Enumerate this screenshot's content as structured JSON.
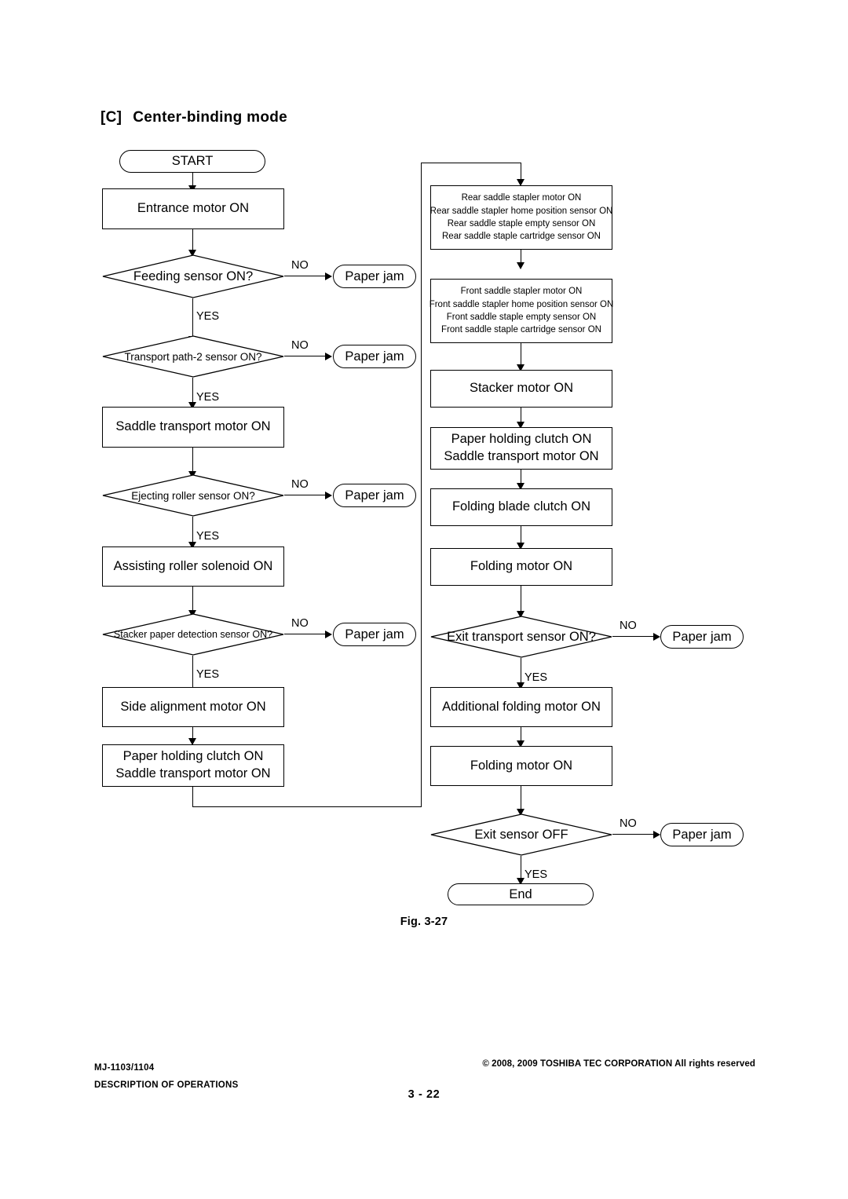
{
  "heading": {
    "tag": "[C]",
    "title": "Center-binding mode"
  },
  "figure_caption": "Fig. 3-27",
  "footer": {
    "model": "MJ-1103/1104",
    "section": "DESCRIPTION OF OPERATIONS",
    "copyright": "© 2008, 2009 TOSHIBA TEC CORPORATION All rights reserved",
    "page": "3 - 22"
  },
  "labels": {
    "yes": "YES",
    "no": "NO"
  },
  "flow": {
    "start": "START",
    "end": "End",
    "paper_jam": "Paper jam",
    "left_column": [
      {
        "id": "entrance-motor-on",
        "type": "process",
        "lines": [
          "Entrance motor ON"
        ]
      },
      {
        "id": "feeding-sensor-on",
        "type": "decision",
        "lines": [
          "Feeding sensor ON?"
        ]
      },
      {
        "id": "transport-path-2-sensor-on",
        "type": "decision",
        "lines": [
          "Transport path-2 sensor ON?"
        ]
      },
      {
        "id": "saddle-transport-motor-on",
        "type": "process",
        "lines": [
          "Saddle transport motor ON"
        ]
      },
      {
        "id": "ejecting-roller-sensor-on",
        "type": "decision",
        "lines": [
          "Ejecting roller sensor ON?"
        ]
      },
      {
        "id": "assisting-roller-solenoid-on",
        "type": "process",
        "lines": [
          "Assisting roller solenoid ON"
        ]
      },
      {
        "id": "stacker-paper-detection-sensor-on",
        "type": "decision",
        "lines": [
          "Stacker paper detection sensor ON?"
        ]
      },
      {
        "id": "side-alignment-motor-on",
        "type": "process",
        "lines": [
          "Side alignment motor ON"
        ]
      },
      {
        "id": "paper-holding-clutch-on-1",
        "type": "process",
        "lines": [
          "Paper holding clutch ON",
          "Saddle transport motor ON"
        ]
      }
    ],
    "right_column": [
      {
        "id": "rear-saddle-stapler-block",
        "type": "process",
        "lines": [
          "Rear saddle stapler motor ON",
          "Rear saddle stapler home position sensor ON",
          "Rear saddle staple empty sensor ON",
          "Rear saddle staple cartridge sensor  ON"
        ]
      },
      {
        "id": "front-saddle-stapler-block",
        "type": "process",
        "lines": [
          "Front saddle stapler motor ON",
          "Front saddle stapler home position sensor ON",
          "Front saddle staple empty sensor ON",
          "Front saddle staple cartridge sensor  ON"
        ]
      },
      {
        "id": "stacker-motor-on",
        "type": "process",
        "lines": [
          "Stacker motor ON"
        ]
      },
      {
        "id": "paper-holding-clutch-on-2",
        "type": "process",
        "lines": [
          "Paper holding clutch ON",
          "Saddle transport motor ON"
        ]
      },
      {
        "id": "folding-blade-clutch-on",
        "type": "process",
        "lines": [
          "Folding blade clutch ON"
        ]
      },
      {
        "id": "folding-motor-on-1",
        "type": "process",
        "lines": [
          "Folding motor ON"
        ]
      },
      {
        "id": "exit-transport-sensor-on",
        "type": "decision",
        "lines": [
          "Exit transport sensor ON?"
        ]
      },
      {
        "id": "additional-folding-motor-on",
        "type": "process",
        "lines": [
          "Additional folding motor ON"
        ]
      },
      {
        "id": "folding-motor-on-2",
        "type": "process",
        "lines": [
          "Folding motor ON"
        ]
      },
      {
        "id": "exit-sensor-off",
        "type": "decision",
        "lines": [
          "Exit sensor OFF"
        ]
      }
    ]
  }
}
